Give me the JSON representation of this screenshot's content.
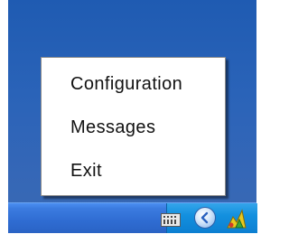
{
  "context_menu": {
    "items": [
      {
        "label": "Configuration"
      },
      {
        "label": "Messages"
      },
      {
        "label": "Exit"
      }
    ]
  },
  "tray": {
    "icons": [
      "keyboard-icon",
      "chevron-left-icon",
      "app-tray-icon"
    ]
  },
  "colors": {
    "desktop": "#2a63b8",
    "taskbar": "#2f6cd2",
    "tray": "#1390df",
    "menu_background": "#ffffff"
  }
}
